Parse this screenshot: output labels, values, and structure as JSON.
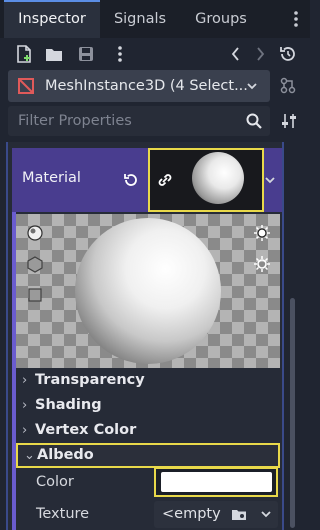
{
  "tabs": [
    {
      "label": "Inspector",
      "active": true
    },
    {
      "label": "Signals",
      "active": false
    },
    {
      "label": "Groups",
      "active": false
    }
  ],
  "node_selector": {
    "label": "MeshInstance3D (4 Select..."
  },
  "filter": {
    "placeholder": "Filter Properties"
  },
  "material": {
    "label": "Material"
  },
  "groups": [
    {
      "label": "Transparency",
      "expanded": false
    },
    {
      "label": "Shading",
      "expanded": false
    },
    {
      "label": "Vertex Color",
      "expanded": false
    },
    {
      "label": "Albedo",
      "expanded": true
    }
  ],
  "albedo": {
    "color_label": "Color",
    "color_value": "#ffffff",
    "texture_label": "Texture",
    "texture_value": "<empty"
  },
  "colors": {
    "accent_purple": "#493d8f",
    "highlight_yellow": "#e9d94a",
    "active_tab_line": "#5b8ee6",
    "node_icon_red": "#e05a5a"
  },
  "icons": [
    "more-vert-icon",
    "new-resource-icon",
    "open-folder-icon",
    "save-icon",
    "back-arrow-icon",
    "forward-arrow-icon",
    "history-icon",
    "node-mesh-icon",
    "dropdown-icon",
    "object-properties-icon",
    "search-icon",
    "filter-sort-icon",
    "revert-icon",
    "link-icon",
    "sphere-preview-icon",
    "box-preview-icon",
    "plane-preview-icon",
    "light1-icon",
    "light2-icon",
    "folder-load-icon"
  ]
}
